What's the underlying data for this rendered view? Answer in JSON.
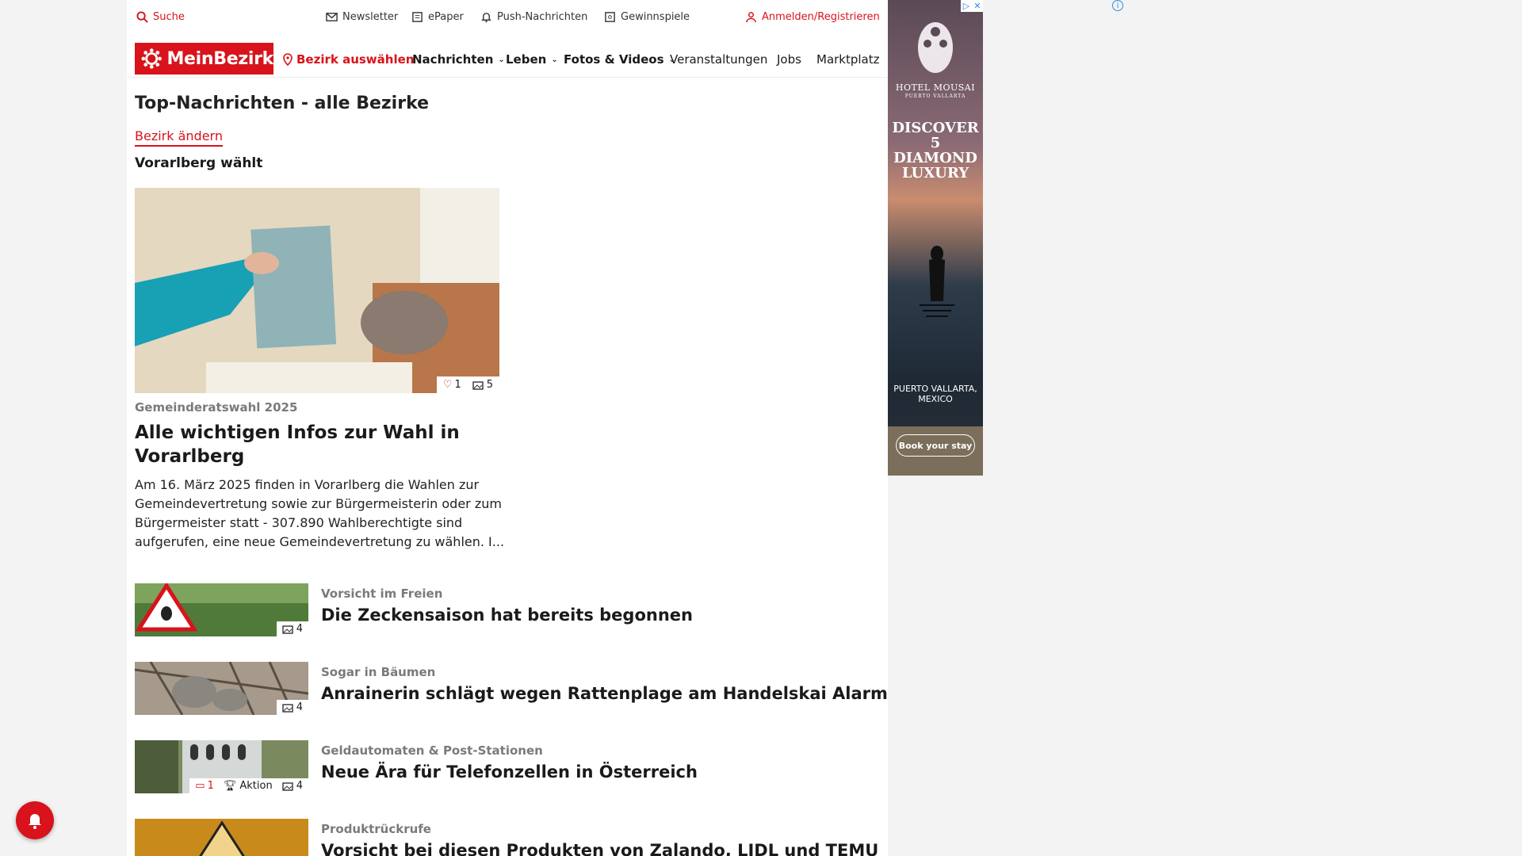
{
  "utility_bar": {
    "search": "Suche",
    "newsletter": "Newsletter",
    "epaper": "ePaper",
    "push": "Push-Nachrichten",
    "contests": "Gewinnspiele",
    "login": "Anmelden/Registrieren"
  },
  "nav": {
    "logo": "MeinBezirk",
    "district_select": "Bezirk auswählen",
    "items": [
      "Nachrichten",
      "Leben",
      "Fotos & Videos",
      "Veranstaltungen",
      "Jobs",
      "Marktplatz"
    ]
  },
  "section": {
    "title": "Top-Nachrichten - alle Bezirke",
    "change_link": "Bezirk ändern",
    "subheading": "Vorarlberg wählt"
  },
  "hero": {
    "likes": "1",
    "images": "5",
    "kicker": "Gemeinderatswahl 2025",
    "title": "Alle wichtigen Infos zur Wahl in Vorarlberg",
    "teaser": "Am 16. März 2025 finden in Vorarlberg die Wahlen zur Gemeindevertretung sowie zur Bürgermeisterin oder zum Bürgermeister statt - 307.890 Wahlberechtigte sind aufgerufen, eine neue Gemeindevertretung zu wählen. I..."
  },
  "articles": [
    {
      "kicker": "Vorsicht im Freien",
      "title": "Die Zeckensaison hat bereits begonnen",
      "images": "4"
    },
    {
      "kicker": "Sogar in Bäumen",
      "title": "Anrainerin schlägt wegen Rattenplage am Handelskai Alarm",
      "images": "4"
    },
    {
      "kicker": "Geldautomaten & Post-Stationen",
      "title": "Neue Ära für Telefonzellen in Österreich",
      "comments": "1",
      "badge": "Aktion",
      "images": "4"
    },
    {
      "kicker": "Produktrückrufe",
      "title": "Vorsicht bei diesen Produkten von Zalando, LIDL und TEMU",
      "images": ""
    }
  ],
  "ad": {
    "brand": "HOTEL MOUSAI",
    "sub": "PUERTO VALLARTA",
    "headline": "DISCOVER 5 DIAMOND LUXURY",
    "location": "PUERTO VALLARTA, MEXICO",
    "cta": "Book your stay"
  },
  "colors": {
    "brand_red": "#d8131b"
  }
}
